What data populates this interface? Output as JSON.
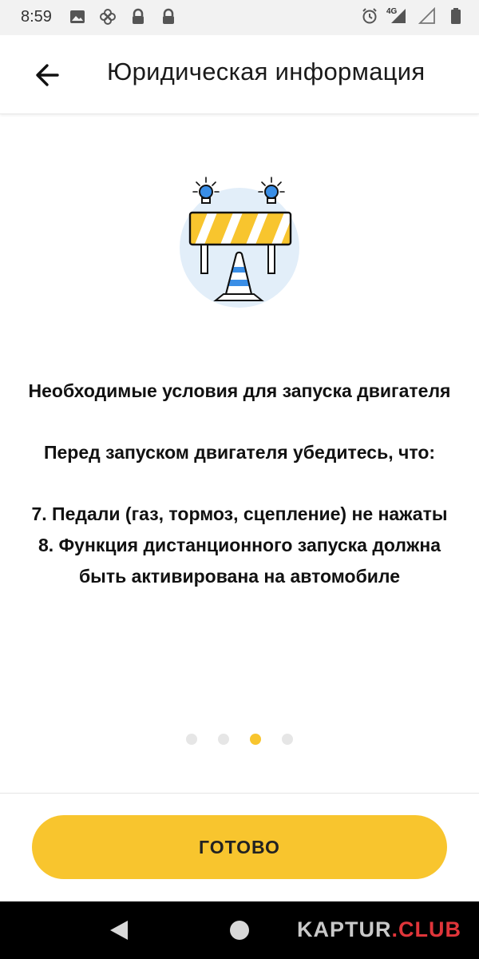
{
  "status_bar": {
    "time": "8:59",
    "network": "4G",
    "icons": [
      "image-icon",
      "pinwheel-icon",
      "lock-icon",
      "lock-icon",
      "alarm-icon",
      "signal-icon",
      "signal-empty-icon",
      "battery-icon"
    ]
  },
  "header": {
    "title": "Юридическая информация",
    "back_icon": "arrow-left-icon"
  },
  "content": {
    "heading": "Необходимые условия для запуска двигателя",
    "intro": "Перед запуском двигателя убедитесь, что:",
    "items": [
      "7. Педали (газ, тормоз, сцепление) не нажаты",
      "8. Функция дистанционного запуска должна быть активирована на автомобиле"
    ]
  },
  "pagination": {
    "total": 4,
    "active_index": 2
  },
  "actions": {
    "done_label": "ГОТОВО"
  },
  "watermark": {
    "part1": "KAPTUR",
    "dot": ".",
    "part2": "CLUB"
  },
  "colors": {
    "accent": "#f8c52e",
    "bubble": "#e2eef9",
    "beacon": "#3a8ee6",
    "watermark_accent": "#e0353a"
  }
}
